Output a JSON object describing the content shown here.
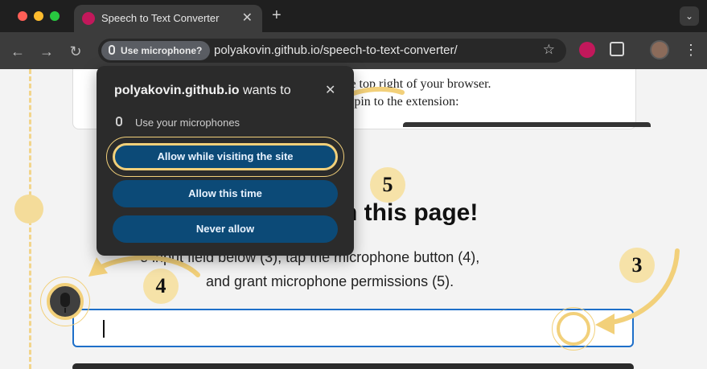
{
  "browser": {
    "tab_title": "Speech to Text Converter",
    "new_tab_label": "+",
    "url": "polyakovin.github.io/speech-to-text-converter/",
    "permission_chip": "Use microphone?"
  },
  "page": {
    "card_line1": "the top right of your browser.",
    "card_line2": "2) pin to the extension:",
    "heading": "n this page!",
    "instruction_line1": "e input field below (3), tap the microphone button (4),",
    "instruction_line2": "and grant microphone permissions (5)."
  },
  "popup": {
    "site": "polyakovin.github.io",
    "wants_to": " wants to",
    "permission": "Use your microphones",
    "buttons": [
      "Allow while visiting the site",
      "Allow this time",
      "Never allow"
    ]
  },
  "badges": [
    "3",
    "4",
    "5"
  ],
  "colors": {
    "accent_yellow": "#f2d07a",
    "button_blue": "#0c4a77",
    "field_border": "#1e6fc9"
  },
  "icons": [
    "close-icon",
    "mic-icon",
    "star-icon",
    "puzzle-icon",
    "kebab-icon",
    "back-icon",
    "forward-icon",
    "reload-icon"
  ]
}
